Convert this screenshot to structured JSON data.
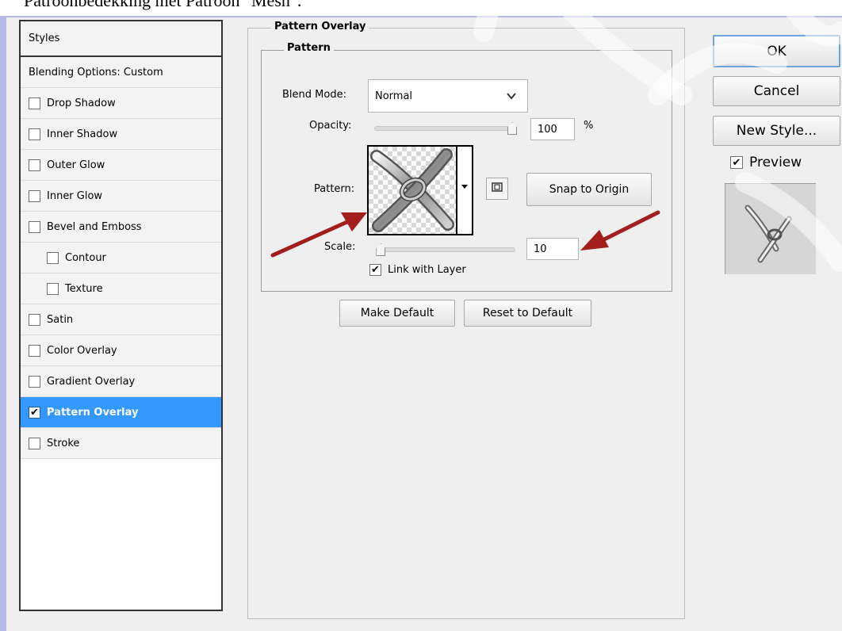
{
  "caption": "Patroonbedekking met Patroon \"Mesh\".",
  "styles_panel": {
    "header": "Styles",
    "items": [
      {
        "label": "Blending Options: Custom",
        "checkbox": false,
        "checked": false,
        "indent": false,
        "selected": false
      },
      {
        "label": "Drop Shadow",
        "checkbox": true,
        "checked": false,
        "indent": false,
        "selected": false
      },
      {
        "label": "Inner Shadow",
        "checkbox": true,
        "checked": false,
        "indent": false,
        "selected": false
      },
      {
        "label": "Outer Glow",
        "checkbox": true,
        "checked": false,
        "indent": false,
        "selected": false
      },
      {
        "label": "Inner Glow",
        "checkbox": true,
        "checked": false,
        "indent": false,
        "selected": false
      },
      {
        "label": "Bevel and Emboss",
        "checkbox": true,
        "checked": false,
        "indent": false,
        "selected": false
      },
      {
        "label": "Contour",
        "checkbox": true,
        "checked": false,
        "indent": true,
        "selected": false
      },
      {
        "label": "Texture",
        "checkbox": true,
        "checked": false,
        "indent": true,
        "selected": false
      },
      {
        "label": "Satin",
        "checkbox": true,
        "checked": false,
        "indent": false,
        "selected": false
      },
      {
        "label": "Color Overlay",
        "checkbox": true,
        "checked": false,
        "indent": false,
        "selected": false
      },
      {
        "label": "Gradient Overlay",
        "checkbox": true,
        "checked": false,
        "indent": false,
        "selected": false
      },
      {
        "label": "Pattern Overlay",
        "checkbox": true,
        "checked": true,
        "indent": false,
        "selected": true
      },
      {
        "label": "Stroke",
        "checkbox": true,
        "checked": false,
        "indent": false,
        "selected": false
      }
    ]
  },
  "pattern_overlay": {
    "group_title": "Pattern Overlay",
    "subgroup_title": "Pattern",
    "blend_mode_label": "Blend Mode:",
    "blend_mode_value": "Normal",
    "opacity_label": "Opacity:",
    "opacity_value": "100",
    "opacity_unit": "%",
    "opacity_level": 1.0,
    "pattern_label": "Pattern:",
    "snap_to_origin_label": "Snap to Origin",
    "scale_label": "Scale:",
    "scale_value": "10",
    "scale_level": 0.1,
    "link_with_layer_label": "Link with Layer",
    "link_with_layer_checked": true,
    "make_default_label": "Make Default",
    "reset_to_default_label": "Reset to Default"
  },
  "side_buttons": {
    "ok_label": "OK",
    "cancel_label": "Cancel",
    "new_style_label": "New Style...",
    "preview_label": "Preview",
    "preview_checked": true
  },
  "colors": {
    "dialog_frame": "#b4b9e6",
    "selected_item": "#3399ff",
    "annotation_arrow": "#a31d1d"
  },
  "icons": {
    "dropdown": "chevron-down-icon",
    "pattern_picker": "triangle-down-icon",
    "new_preset": "new-preset-icon",
    "check": "check-icon"
  }
}
